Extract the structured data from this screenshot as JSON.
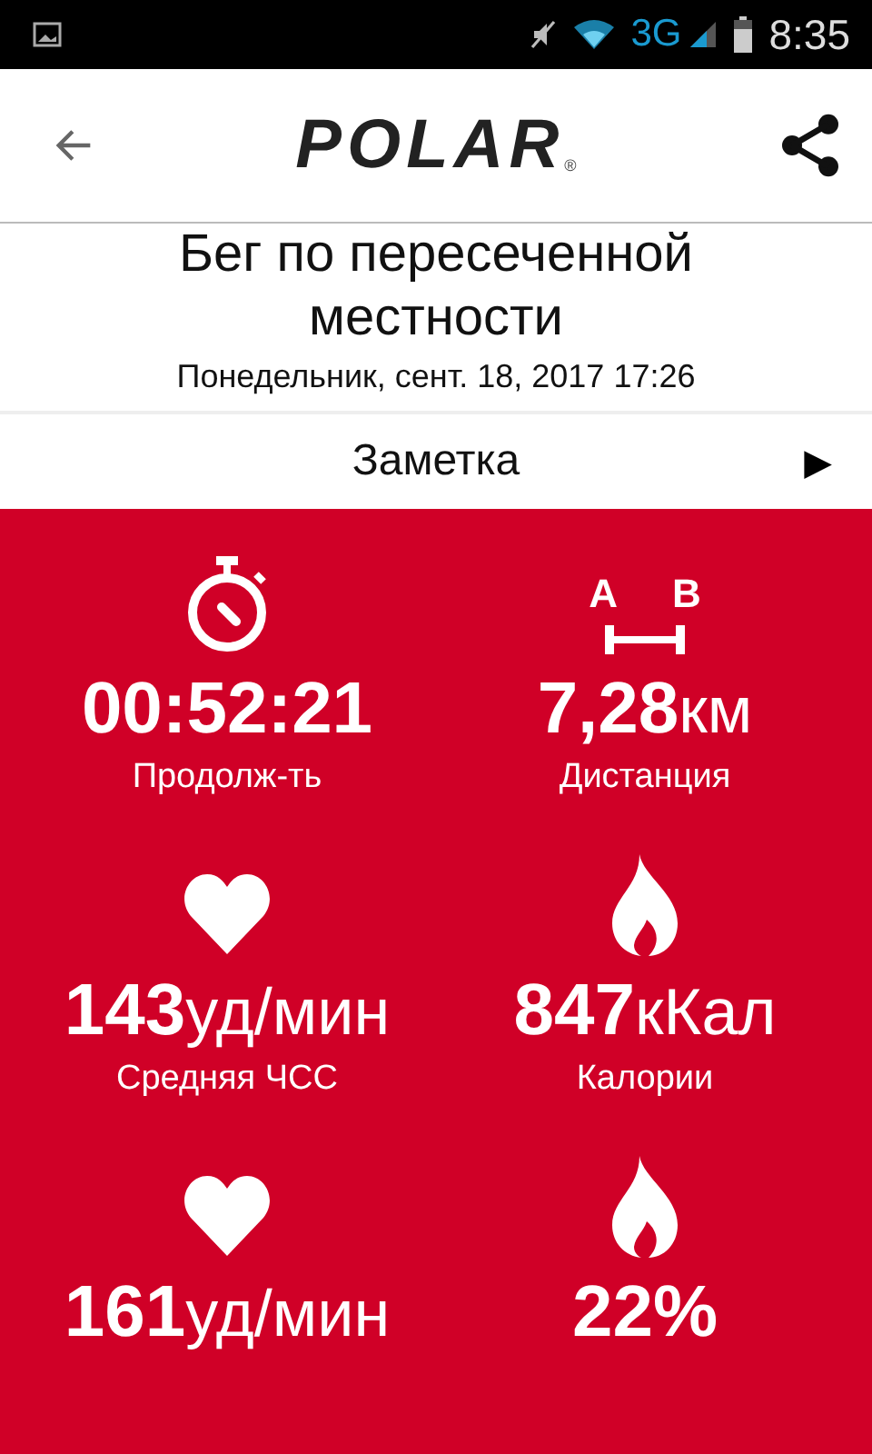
{
  "status_bar": {
    "network": "3G",
    "time": "8:35"
  },
  "header": {
    "logo": "POLAR",
    "registered": "®"
  },
  "workout": {
    "title_lines": [
      "Бег по пересеченной",
      "местности"
    ],
    "date": "Понедельник, сент. 18, 2017 17:26"
  },
  "note_row": {
    "label": "Заметка",
    "arrow": "▶"
  },
  "metrics": [
    {
      "kind": "stopwatch",
      "value": "00:52:21",
      "label": "Продолж-ть"
    },
    {
      "kind": "distance",
      "value": "7,28",
      "unit": "км",
      "label": "Дистанция"
    },
    {
      "kind": "heart",
      "value": "143",
      "unit": "уд/мин",
      "label": "Средняя ЧСС"
    },
    {
      "kind": "flame",
      "value": "847",
      "unit": "кКал",
      "label": "Калории"
    },
    {
      "kind": "heart",
      "value": "161",
      "unit": "уд/мин"
    },
    {
      "kind": "flame",
      "value": "22%"
    }
  ],
  "distance_icon": {
    "markers": [
      "A",
      "B"
    ]
  }
}
